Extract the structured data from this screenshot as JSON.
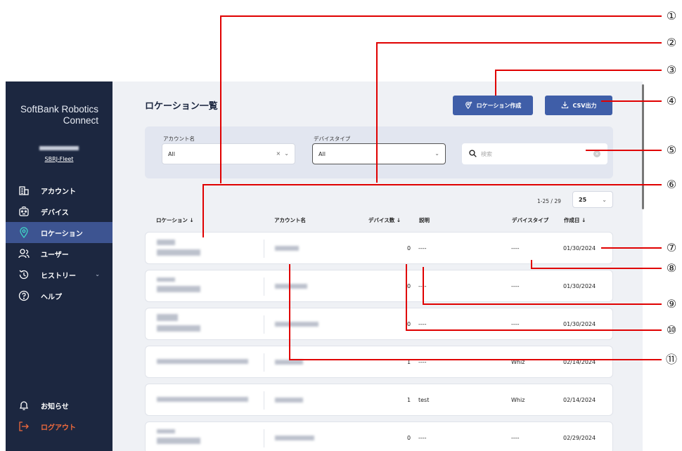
{
  "sidebar": {
    "brand_line1": "SoftBank Robotics",
    "brand_line2": "Connect",
    "collapse_glyph": "‹",
    "org_name": "SBRJ-Fleet",
    "items": [
      {
        "label": "アカウント",
        "icon": "building-icon"
      },
      {
        "label": "デバイス",
        "icon": "robot-icon"
      },
      {
        "label": "ロケーション",
        "icon": "location-pin-icon"
      },
      {
        "label": "ユーザー",
        "icon": "users-icon"
      },
      {
        "label": "ヒストリー",
        "icon": "history-icon"
      },
      {
        "label": "ヘルプ",
        "icon": "help-icon"
      }
    ],
    "active_index": 2,
    "notice_label": "お知らせ",
    "logout_label": "ログアウト"
  },
  "main": {
    "title": "ロケーション一覧",
    "create_button": "ロケーション作成",
    "csv_button": "CSV出力",
    "filters": {
      "account_label": "アカウント名",
      "account_value": "All",
      "account_clear": "×",
      "device_type_label": "デバイスタイプ",
      "device_type_value": "All",
      "search_placeholder": "検索"
    },
    "pagination": {
      "range": "1-25 / 29",
      "per_page": "25"
    },
    "columns": {
      "location": "ロケーション ↓",
      "account": "アカウント名",
      "device_count": "デバイス数 ↓",
      "description": "説明",
      "device_type": "デバイスタイプ",
      "created": "作成日 ↓"
    },
    "rows": [
      {
        "device_count": "0",
        "description": "----",
        "device_type": "----",
        "created": "01/30/2024"
      },
      {
        "device_count": "0",
        "description": "----",
        "device_type": "----",
        "created": "01/30/2024"
      },
      {
        "device_count": "0",
        "description": "----",
        "device_type": "----",
        "created": "01/30/2024"
      },
      {
        "device_count": "1",
        "description": "----",
        "device_type": "Whiz",
        "created": "02/14/2024"
      },
      {
        "device_count": "1",
        "description": "test",
        "device_type": "Whiz",
        "created": "02/14/2024"
      },
      {
        "device_count": "0",
        "description": "----",
        "device_type": "----",
        "created": "02/29/2024"
      }
    ]
  },
  "callouts": [
    "①",
    "②",
    "③",
    "④",
    "⑤",
    "⑥",
    "⑦",
    "⑧",
    "⑨",
    "⑩",
    "⑪"
  ],
  "colors": {
    "sidebar": "#1c2740",
    "active": "#3d5491",
    "button": "#3f5ea8",
    "annotation": "#e00000",
    "logout": "#f06a3c"
  }
}
